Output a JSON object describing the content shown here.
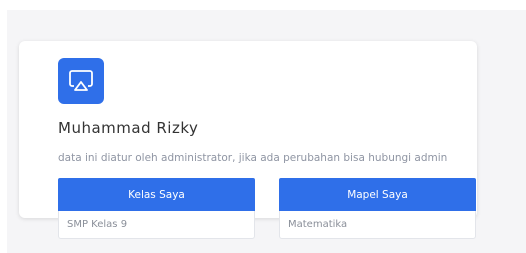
{
  "profile": {
    "icon": "airplay-icon",
    "name": "Muhammad Rizky",
    "note": "data ini diatur oleh administrator, jika ada perubahan bisa hubungi admin"
  },
  "info": {
    "class_label": "Kelas Saya",
    "class_value": "SMP Kelas 9",
    "subject_label": "Mapel Saya",
    "subject_value": "Matematika"
  },
  "colors": {
    "accent": "#2f6fe9",
    "muted_text": "#8f95a3"
  }
}
